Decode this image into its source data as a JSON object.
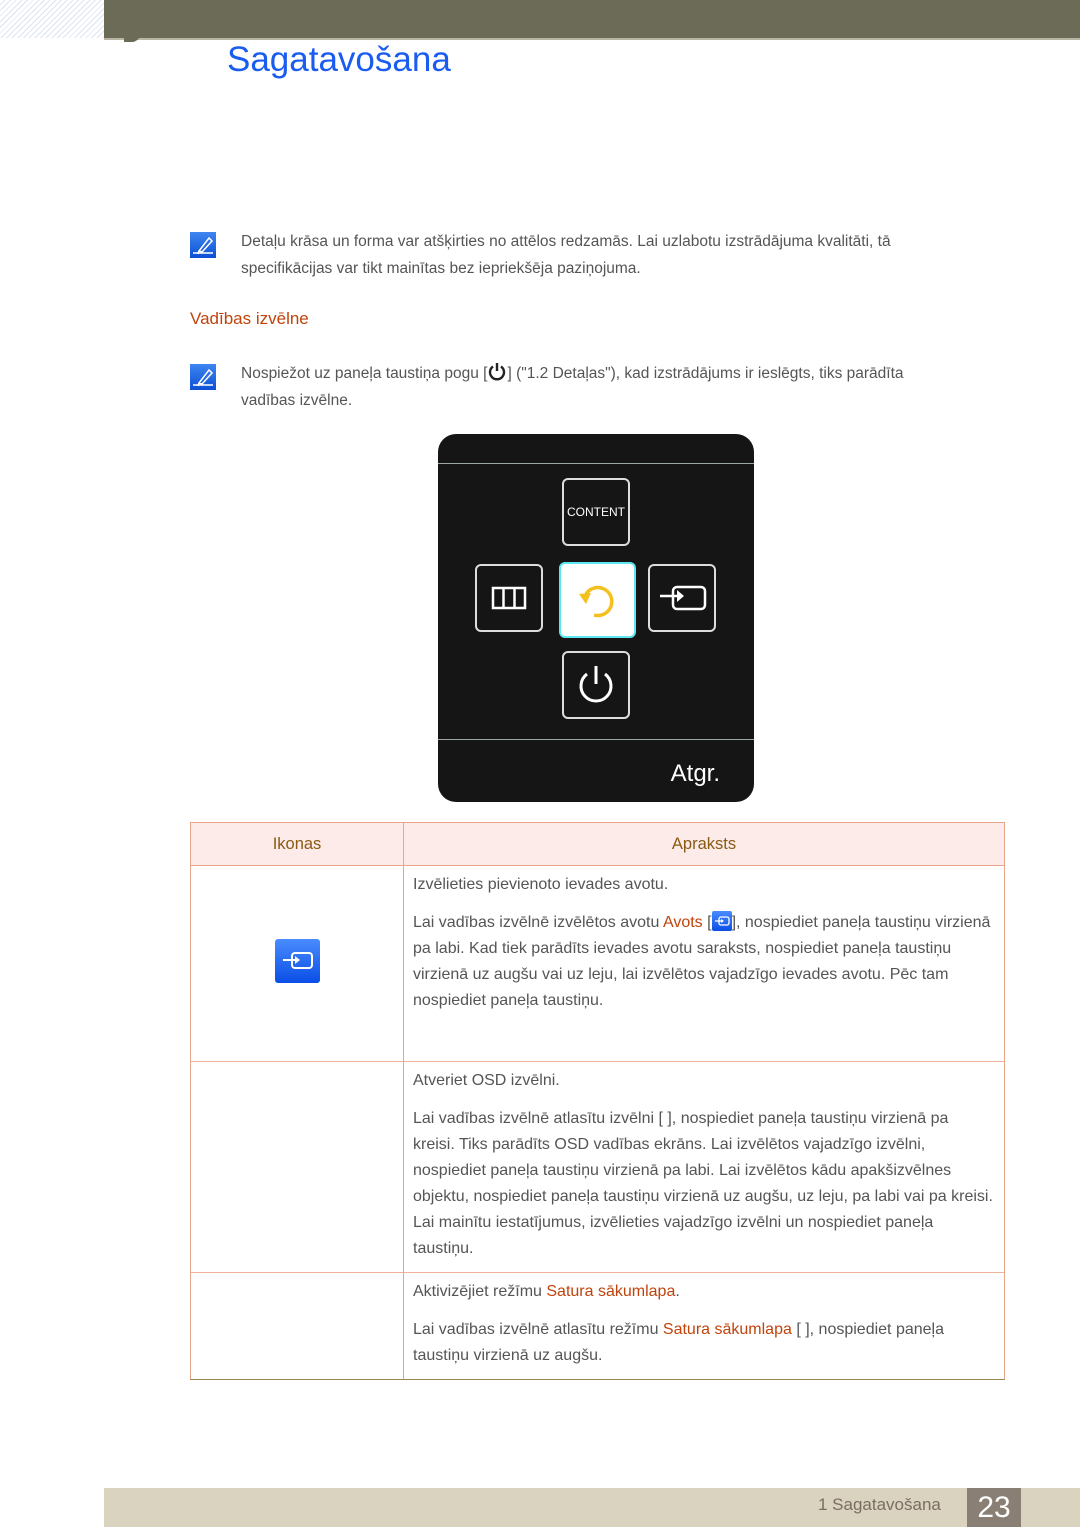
{
  "header": {
    "title": "Sagatavošana"
  },
  "notes": [
    {
      "icon": "note-pencil-icon",
      "lines": [
        "Detaļu krāsa un forma var atšķirties no attēlos redzamās. Lai uzlabotu izstrādājuma kvalitāti, tā",
        "specifikācijas var tikt mainītas bez iepriekšēja paziņojuma."
      ]
    },
    {
      "icon": "note-pencil-icon",
      "before": "Nospiežot uz paneļa taustiņa pogu [",
      "inline_icon": "power-icon",
      "after": "] (\"1.2 Detaļas\"), kad izstrādājums ir ieslēgts, tiks parādīta",
      "line2": "vadības izvēlne."
    }
  ],
  "section": {
    "title": "Vadības izvēlne"
  },
  "osd": {
    "buttons": [
      {
        "id": "content",
        "label": "CONTENT",
        "icon": "content-icon"
      },
      {
        "id": "menu",
        "icon": "menu-icon"
      },
      {
        "id": "return",
        "icon": "return-icon",
        "selected": true
      },
      {
        "id": "source",
        "icon": "source-icon"
      },
      {
        "id": "power",
        "icon": "power-icon"
      }
    ],
    "footer_label": "Atgr.",
    "colors": {
      "background": "#151515",
      "selected_border": "#5ee6f0",
      "return_arrow": "#f4c01e"
    }
  },
  "table": {
    "headers": [
      "Ikonas",
      "Apraksts"
    ],
    "rows": [
      {
        "icon": "source-icon",
        "p1": "Izvēlieties pievienoto ievades avotu.",
        "p2_before": "Lai vadības izvēlnē izvēlētos avotu ",
        "p2_highlight": "Avots",
        "p2_after_bracket_open": " [",
        "p2_after": "], nospiediet paneļa taustiņu virzienā pa labi. Kad tiek parādīts ievades avotu saraksts, nospiediet paneļa taustiņu virzienā uz augšu vai uz leju, lai izvēlētos vajadzīgo ievades avotu. Pēc tam nospiediet paneļa taustiņu."
      },
      {
        "icon": "",
        "p1": "Atveriet OSD izvēlni.",
        "p2": "Lai vadības izvēlnē atlasītu izvēlni [      ], nospiediet paneļa taustiņu virzienā pa kreisi. Tiks parādīts OSD vadības ekrāns. Lai izvēlētos vajadzīgo izvēlni, nospiediet paneļa taustiņu virzienā pa labi. Lai izvēlētos kādu apakšizvēlnes objektu, nospiediet paneļa taustiņu virzienā uz augšu, uz leju, pa labi vai pa kreisi. Lai mainītu iestatījumus, izvēlieties vajadzīgo izvēlni un nospiediet paneļa taustiņu."
      },
      {
        "icon": "",
        "p1_before": "Aktivizējiet režīmu ",
        "p1_highlight": "Satura sākumlapa",
        "p1_after": ".",
        "p2_before": "Lai vadības izvēlnē atlasītu režīmu ",
        "p2_highlight": "Satura sākumlapa",
        "p2_after": " [      ], nospiediet paneļa taustiņu virzienā uz augšu."
      }
    ]
  },
  "footer": {
    "chapter_label": "1 Sagatavošana",
    "page_number": "23"
  }
}
